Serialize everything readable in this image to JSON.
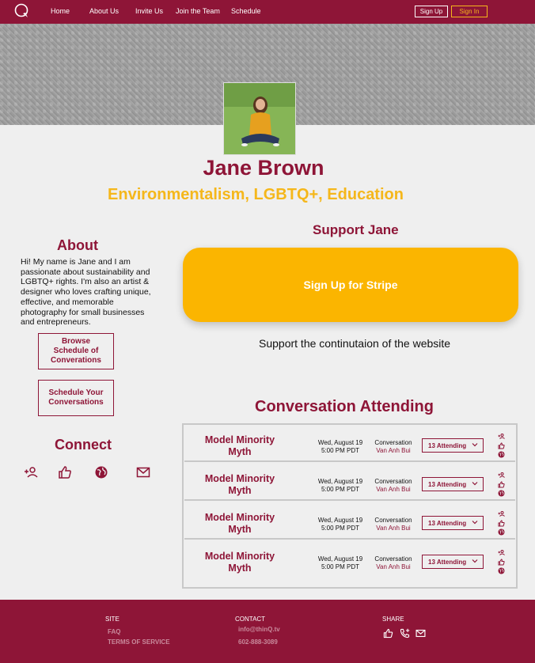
{
  "nav": {
    "items": [
      "Home",
      "About Us",
      "Invite Us",
      "Join the Team",
      "Schedule"
    ],
    "signup_label": "Sign Up",
    "signin_label": "Sign In"
  },
  "profile": {
    "name": "Jane Brown",
    "tagline": "Environmentalism, LGBTQ+, Education"
  },
  "about": {
    "heading": "About",
    "text": "Hi! My name is Jane and I am passionate about sustainability and LGBTQ+ rights. I'm also an artist & designer who loves crafting unique, effective, and memorable photography for small businesses and entrepreneurs.",
    "browse_label": "Browse Schedule of Converations",
    "schedule_label": "Schedule Your Conversations"
  },
  "connect": {
    "heading": "Connect",
    "icons": [
      "add-person-icon",
      "thumbs-up-icon",
      "globe-icon",
      "mail-icon"
    ]
  },
  "support": {
    "heading": "Support Jane",
    "stripe_label": "Sign Up for Stripe",
    "note": "Support the continutaion of the website"
  },
  "conversations": {
    "heading": "Conversation Attending",
    "rows": [
      {
        "title": "Model Minority Myth",
        "date": "Wed, August 19",
        "time": "5:00 PM PDT",
        "type": "Conversation",
        "host": "Van Anh Bui",
        "attending": "13 Attending"
      },
      {
        "title": "Model Minority Myth",
        "date": "Wed, August 19",
        "time": "5:00 PM PDT",
        "type": "Conversation",
        "host": "Van Anh Bui",
        "attending": "13 Attending"
      },
      {
        "title": "Model Minority Myth",
        "date": "Wed, August 19",
        "time": "5:00 PM PDT",
        "type": "Conversation",
        "host": "Van Anh Bui",
        "attending": "13 Attending"
      },
      {
        "title": "Model Minority Myth",
        "date": "Wed, August 19",
        "time": "5:00 PM PDT",
        "type": "Conversation",
        "host": "Van Anh Bui",
        "attending": "13 Attending"
      }
    ]
  },
  "footer": {
    "site_heading": "SITE",
    "faq": "FAQ",
    "terms": "TERMS OF SERVICE",
    "contact_heading": "CONTACT",
    "email": "info@thinQ.tv",
    "phone": "602-888-3089",
    "share_heading": "SHARE"
  },
  "colors": {
    "maroon": "#8e1537",
    "gold": "#f5b71b",
    "stripe": "#fbb500"
  }
}
